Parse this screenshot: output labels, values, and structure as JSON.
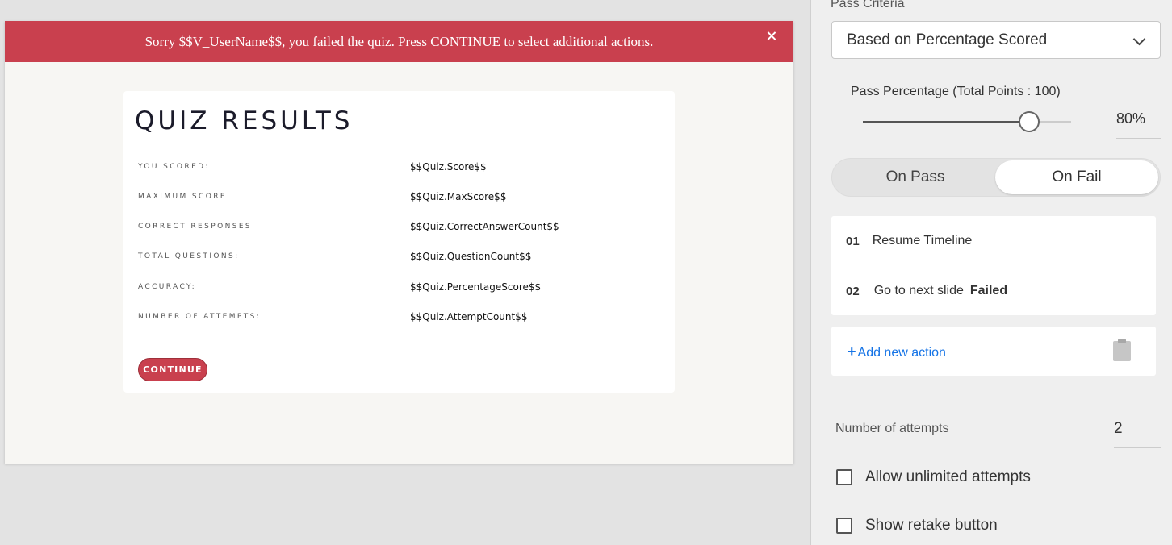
{
  "slide": {
    "banner_text": "Sorry $$V_UserName$$, you failed the quiz. Press CONTINUE to select additional actions.",
    "card_title": "QUIZ RESULTS",
    "rows": [
      {
        "label": "YOU SCORED:",
        "value": "$$Quiz.Score$$"
      },
      {
        "label": "MAXIMUM SCORE:",
        "value": "$$Quiz.MaxScore$$"
      },
      {
        "label": "CORRECT RESPONSES:",
        "value": "$$Quiz.CorrectAnswerCount$$"
      },
      {
        "label": "TOTAL QUESTIONS:",
        "value": "$$Quiz.QuestionCount$$"
      },
      {
        "label": "ACCURACY:",
        "value": "$$Quiz.PercentageScore$$"
      },
      {
        "label": "NUMBER OF ATTEMPTS:",
        "value": "$$Quiz.AttemptCount$$"
      }
    ],
    "continue_label": "CONTINUE"
  },
  "panel": {
    "pass_criteria_label": "Pass Criteria",
    "pass_criteria_value": "Based on Percentage Scored",
    "pass_percentage_label": "Pass Percentage (Total Points : 100)",
    "pass_percentage_value": "80%",
    "pass_percentage_fraction": 0.8,
    "tabs": [
      {
        "label": "On Pass",
        "active": false
      },
      {
        "label": "On Fail",
        "active": true
      }
    ],
    "actions": [
      {
        "num": "01",
        "text": "Resume Timeline",
        "bold": ""
      },
      {
        "num": "02",
        "text": "Go to next slide",
        "bold": "Failed"
      }
    ],
    "add_action_plus": "+",
    "add_action_label": "Add new action",
    "attempts_label": "Number of attempts",
    "attempts_value": "2",
    "unlimited_label": "Allow unlimited attempts",
    "unlimited_checked": false,
    "retake_label": "Show retake button",
    "retake_checked": false
  },
  "colors": {
    "banner": "#c9404e",
    "link": "#1473e6"
  },
  "icons": {
    "banner_close": "close-icon",
    "dropdown": "chevron-down-icon",
    "paste": "clipboard-icon"
  }
}
